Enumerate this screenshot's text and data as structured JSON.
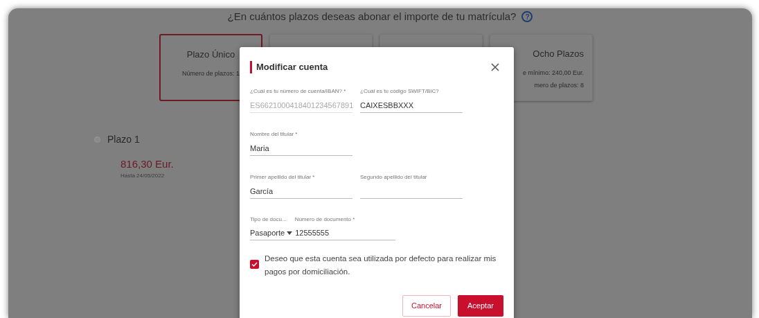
{
  "page": {
    "question": "¿En cuántos plazos deseas abonar el importe de tu matrícula?",
    "help": "?",
    "plans": [
      {
        "title": "Plazo Único",
        "lines": [
          "Número de plazos: 1"
        ],
        "selected": true
      },
      {
        "selected": false
      },
      {
        "selected": false
      },
      {
        "title": "Ocho Plazos",
        "lines": [
          "e mínimo: 240,00 Eur.",
          "mero de plazos: 8"
        ],
        "selected": false
      }
    ],
    "installment": {
      "title": "Plazo 1",
      "amount": "816,30 Eur.",
      "due": "Hasta 24/05/2022"
    }
  },
  "dialog": {
    "title": "Modificar cuenta",
    "fields": [
      {
        "label": "¿Cuál es tu número de cuenta/IBAN? *",
        "value": "ES6621000418401234567891",
        "disabled": true
      },
      {
        "label": "¿Cuál es tu código SWIFT/BIC?",
        "value": "CAIXESBBXXX",
        "disabled": false
      },
      {
        "label": "Nombre del titular *",
        "value": "Maria",
        "disabled": false
      },
      {
        "label": "Primer apellido del titular *",
        "value": "García",
        "disabled": false
      },
      {
        "label": "Segundo apellido del titular",
        "disabled": false
      }
    ],
    "document_type": {
      "label": "Tipo de docu...",
      "value": "Pasaporte"
    },
    "document_number": {
      "label": "Número de documento *",
      "value": "12555555"
    },
    "default_account": {
      "label": "Deseo que esta cuenta sea utilizada por defecto para realizar mis pagos por domiciliación.",
      "checked": true
    },
    "buttons": [
      {
        "label": "Cancelar",
        "kind": "secondary"
      },
      {
        "label": "Aceptar",
        "kind": "primary"
      }
    ]
  }
}
